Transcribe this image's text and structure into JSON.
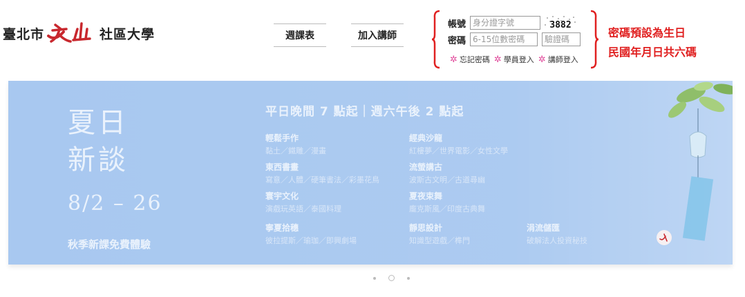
{
  "logo": {
    "part1": "臺北市",
    "part2": "社區大學"
  },
  "nav": [
    {
      "label": "週課表"
    },
    {
      "label": "加入講師"
    }
  ],
  "login": {
    "account_label": "帳號",
    "account_placeholder": "身分證字號",
    "password_label": "密碼",
    "password_placeholder": "6-15位數密碼",
    "captcha_image_text": "3882",
    "captcha_placeholder": "驗證碼",
    "links": [
      "忘記密碼",
      "學員登入",
      "講師登入"
    ]
  },
  "note": {
    "line1": "密碼預設為生日",
    "line2": "民國年月日共六碼"
  },
  "banner": {
    "title_line1": "夏日",
    "title_line2": "新談",
    "date": "8/2 – 26",
    "free": "秋季新課免費體驗",
    "headline": "平日晚間 7 點起｜週六午後 2 點起",
    "courses": [
      {
        "title": "輕鬆手作",
        "sub": "黏土／鐵雕／漫畫"
      },
      {
        "title": "東西書畫",
        "sub": "寫意／人體／硬筆書法／彩墨花鳥"
      },
      {
        "title": "寰宇文化",
        "sub": "演戲玩英語／泰國料理"
      },
      {
        "title": "寧夏拾穗",
        "sub": "彼拉提斯／瑜珈／即興劇場"
      },
      {
        "title": "經典沙龍",
        "sub": "紅樓夢／世界電影／女性文學"
      },
      {
        "title": "流螢講古",
        "sub": "波斯古文明／古道尋幽"
      },
      {
        "title": "夏夜束舞",
        "sub": "龐克斯風／印度古典舞"
      },
      {
        "title": "靜思設計",
        "sub": "知識型遊戲／榫門"
      },
      {
        "title": "涓流儲匯",
        "sub": "破解法人投資秘技"
      }
    ]
  },
  "carousel": {
    "count": 3,
    "active": 2
  },
  "colors": {
    "accent_red": "#e02020",
    "banner_blue": "#a8c8f0",
    "star_pink": "#e0489a"
  }
}
